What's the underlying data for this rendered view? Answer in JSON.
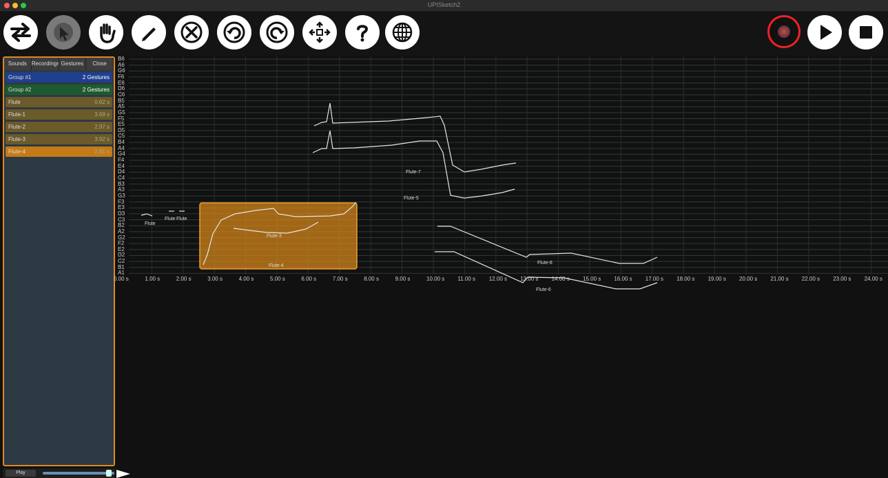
{
  "window": {
    "title": "UPISketch2"
  },
  "toolbar": {
    "left_buttons": [
      {
        "name": "swap-arrows-icon",
        "active": false
      },
      {
        "name": "select-pointer-icon",
        "active": true
      },
      {
        "name": "hand-icon",
        "active": false
      },
      {
        "name": "pencil-icon",
        "active": false
      },
      {
        "name": "delete-x-icon",
        "active": false
      },
      {
        "name": "undo-icon",
        "active": false
      },
      {
        "name": "redo-icon",
        "active": false
      },
      {
        "name": "move-arrows-icon",
        "active": false
      },
      {
        "name": "help-icon",
        "active": false
      },
      {
        "name": "globe-icon",
        "active": false
      }
    ],
    "right_buttons": [
      "record-icon",
      "play-icon",
      "stop-icon"
    ]
  },
  "sidebar": {
    "tabs": [
      "Sounds",
      "Recordings",
      "Gestures",
      "Close"
    ],
    "items": [
      {
        "label": "Group #1",
        "value": "2 Gestures",
        "color": "#1f3f8f"
      },
      {
        "label": "Group #2",
        "value": "2 Gestures",
        "color": "#1e5a2e"
      },
      {
        "label": "Flute",
        "value": "0.62 s",
        "color": "#6b5a2a"
      },
      {
        "label": "Flute-1",
        "value": "3.69 s",
        "color": "#6b5a2a"
      },
      {
        "label": "Flute-2",
        "value": "2.97 s",
        "color": "#6b5a2a"
      },
      {
        "label": "Flute-3",
        "value": "3.92 s",
        "color": "#6b5a2a"
      },
      {
        "label": "Flute-4",
        "value": "2.81 s",
        "color": "#c47b17"
      }
    ],
    "play_label": "Play"
  },
  "editor": {
    "pitch_labels": [
      "B6",
      "A6",
      "G6",
      "F6",
      "E6",
      "D6",
      "C6",
      "B5",
      "A5",
      "G5",
      "F5",
      "E5",
      "D5",
      "C5",
      "B4",
      "A4",
      "G4",
      "F4",
      "E4",
      "D4",
      "C4",
      "B3",
      "A3",
      "G3",
      "F3",
      "E3",
      "D3",
      "C3",
      "B2",
      "A2",
      "G2",
      "F2",
      "E2",
      "D2",
      "C2",
      "B1",
      "A1"
    ],
    "time_labels": [
      "0.00 s",
      "1.00 s",
      "2.00 s",
      "3.00 s",
      "4.00 s",
      "5.00 s",
      "6.00 s",
      "7.00 s",
      "8.00 s",
      "9.00 s",
      "10.00 s",
      "11.00 s",
      "12.00 s",
      "13.00 s",
      "14.00 s",
      "15.00 s",
      "16.00 s",
      "17.00 s",
      "18.00 s",
      "19.00 s",
      "20.00 s",
      "21.00 s",
      "22.00 s",
      "23.00 s",
      "24.00 s"
    ],
    "gesture_labels": [
      "Flute",
      "Flute",
      "Flute",
      "Flute-3",
      "Flute-4",
      "Flute-7",
      "Flute-5",
      "Flute-8",
      "Flute-6"
    ],
    "selection_color": "#d9891b",
    "accent_record": "#e22222"
  }
}
